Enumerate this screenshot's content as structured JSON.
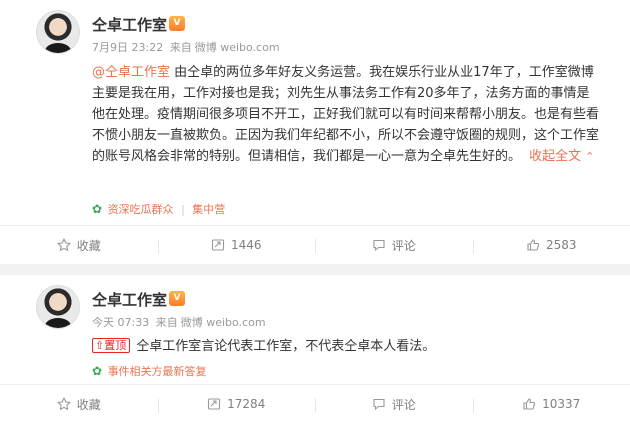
{
  "posts": [
    {
      "author": "仝卓工作室",
      "vip_badge": "V",
      "time": "7月9日 23:22",
      "source_prefix": "来自",
      "source": "微博 weibo.com",
      "mention": "@仝卓工作室",
      "body": " 由仝卓的两位多年好友义务运营。我在娱乐行业从业17年了，工作室微博主要是我在用，工作对接也是我；刘先生从事法务工作有20多年了，法务方面的事情是他在处理。疫情期间很多项目不开工，正好我们就可以有时间来帮帮小朋友。也是有些看不惯小朋友一直被欺负。正因为我们年纪都不小，所以不会遵守饭圈的规则，这个工作室的账号风格会非常的特别。但请相信，我们都是一心一意为仝卓先生好的。",
      "fold_label": "收起全文",
      "topics": [
        "资深吃瓜群众",
        "集中营"
      ],
      "actions": {
        "favorite": "收藏",
        "repost": "1446",
        "comment": "评论",
        "like": "2583"
      }
    },
    {
      "author": "仝卓工作室",
      "vip_badge": "V",
      "time": "今天 07:33",
      "source_prefix": "来自",
      "source": "微博 weibo.com",
      "pinned_label": "置顶",
      "body": "仝卓工作室言论代表工作室，不代表仝卓本人看法。",
      "topics": [
        "事件相关方最新答复"
      ],
      "actions": {
        "favorite": "收藏",
        "repost": "17284",
        "comment": "评论",
        "like": "10337"
      }
    }
  ],
  "colors": {
    "link": "#eb7350",
    "pin": "#e22222",
    "topic_icon": "#3aa757",
    "meta": "#999999"
  }
}
